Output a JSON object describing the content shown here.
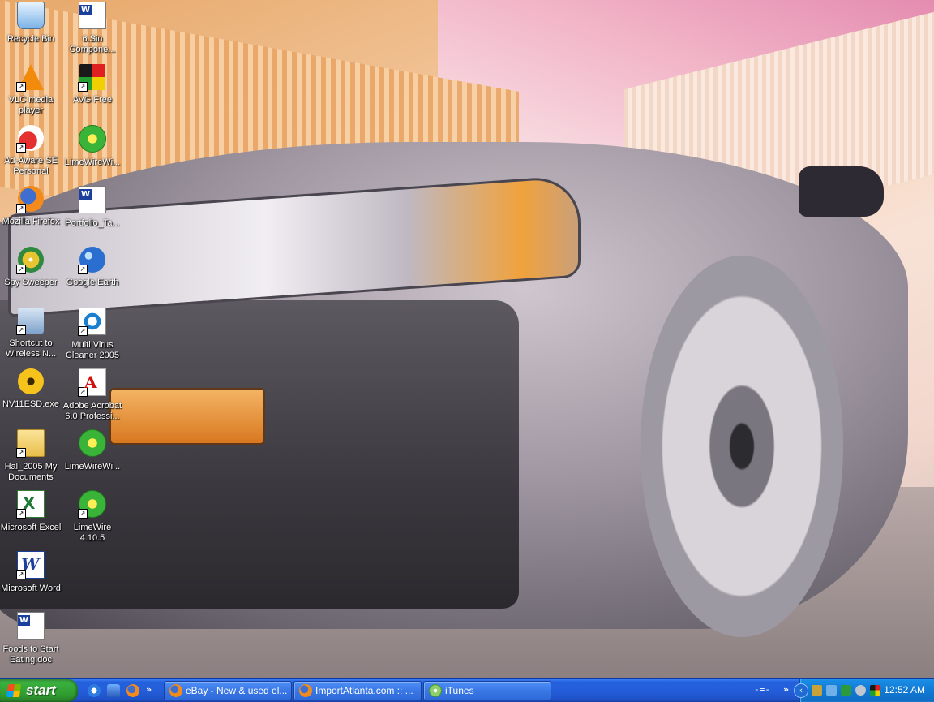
{
  "desktop": {
    "icons": [
      {
        "label": "Recycle Bin"
      },
      {
        "label": "6.Sin Compone..."
      },
      {
        "label": "VLC media player"
      },
      {
        "label": "AVG Free"
      },
      {
        "label": "Ad-Aware SE Personal"
      },
      {
        "label": "LimeWireWi..."
      },
      {
        "label": "Mozilla Firefox"
      },
      {
        "label": "Portfolio_Ta..."
      },
      {
        "label": "Spy Sweeper"
      },
      {
        "label": "Google Earth"
      },
      {
        "label": "Shortcut to Wireless N..."
      },
      {
        "label": "Multi Virus Cleaner 2005"
      },
      {
        "label": "NV11ESD.exe"
      },
      {
        "label": "Adobe Acrobat 6.0 Professi..."
      },
      {
        "label": "Hal_2005 My Documents"
      },
      {
        "label": "LimeWireWi..."
      },
      {
        "label": "Microsoft Excel"
      },
      {
        "label": "LimeWire 4.10.5"
      },
      {
        "label": "Microsoft Word"
      },
      {
        "label": "Foods to Start Eating.doc"
      }
    ]
  },
  "taskbar": {
    "start_label": "start",
    "quick_launch_more": "»",
    "windows": [
      {
        "title": "eBay - New & used el..."
      },
      {
        "title": "ImportAtlanta.com :: ..."
      },
      {
        "title": "iTunes"
      }
    ],
    "toolbar_marker": "-=-",
    "tray_more": "»",
    "clock": "12:52 AM"
  }
}
